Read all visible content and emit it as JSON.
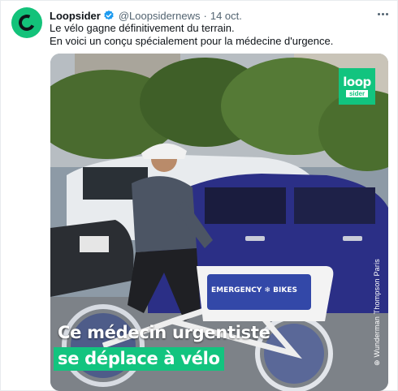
{
  "tweet": {
    "display_name": "Loopsider",
    "handle": "@Loopsidernews",
    "separator": "·",
    "time": "14 oct.",
    "lines": [
      "Le vélo gagne définitivement du terrain.",
      "En voici un conçu spécialement pour la médecine d'urgence."
    ]
  },
  "media": {
    "logo_top": "loop",
    "logo_bottom": "sider",
    "bike_basket_text": "EMERGENCY ❄ BIKES",
    "credit": "⊕ Wunderman Thompson Paris",
    "caption_line1": "Ce médecin urgentiste",
    "caption_line2": "se déplace à vélo"
  },
  "colors": {
    "brand_green": "#12c47f",
    "verified_blue": "#1d9bf0",
    "car_blue": "#2b2f86",
    "secondary_text": "#536471"
  },
  "icons": {
    "verified": "verified-badge-icon",
    "more": "more-horizontal-icon"
  }
}
